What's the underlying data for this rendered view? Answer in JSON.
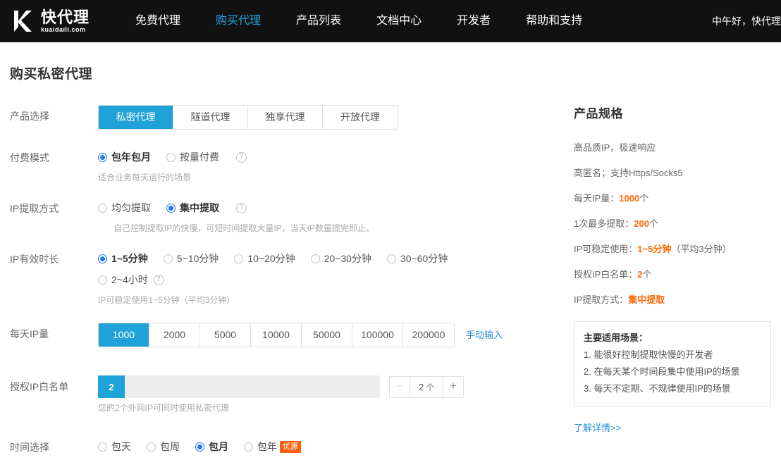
{
  "header": {
    "logo": {
      "cn": "快代理",
      "en": "kuaidaili.com",
      "icon": "k-logo-icon"
    },
    "nav": [
      {
        "label": "免费代理",
        "active": false
      },
      {
        "label": "购买代理",
        "active": true
      },
      {
        "label": "产品列表",
        "active": false
      },
      {
        "label": "文档中心",
        "active": false
      },
      {
        "label": "开发者",
        "active": false
      },
      {
        "label": "帮助和支持",
        "active": false
      }
    ],
    "greeting": "中午好，快代理",
    "active_color": "#2aa3e0",
    "background": "#111111"
  },
  "page": {
    "title": "购买私密代理",
    "accent": "#1fa2d8",
    "radio_accent": "#2277ee",
    "highlight": "#ff6a0a"
  },
  "form": {
    "product_select": {
      "label": "产品选择",
      "options": [
        "私密代理",
        "隧道代理",
        "独享代理",
        "开放代理"
      ],
      "selected": "私密代理"
    },
    "payment_mode": {
      "label": "付费模式",
      "options": [
        "包年包月",
        "按量付费"
      ],
      "selected": "包年包月",
      "help_icon": "question-mark-icon",
      "hint": "适合业务每天运行的场景"
    },
    "extract_method": {
      "label": "IP提取方式",
      "options": [
        "均匀提取",
        "集中提取"
      ],
      "selected": "集中提取",
      "help_icon": "question-mark-icon",
      "hint": "自己控制提取IP的快慢，可短时间提取大量IP，当天IP数量提完即止。"
    },
    "ip_duration": {
      "label": "IP有效时长",
      "options": [
        "1~5分钟",
        "5~10分钟",
        "10~20分钟",
        "20~30分钟",
        "30~60分钟",
        "2~4小时"
      ],
      "selected": "1~5分钟",
      "help_icon": "question-mark-icon",
      "hint": "IP可稳定使用1~5分钟（平均3分钟）"
    },
    "daily_ip": {
      "label": "每天IP量",
      "options": [
        "1000",
        "2000",
        "5000",
        "10000",
        "50000",
        "100000",
        "200000"
      ],
      "selected": "1000",
      "manual_link": "手动输入"
    },
    "whitelist": {
      "label": "授权IP白名单",
      "slider_value": "2",
      "stepper_minus": "−",
      "stepper_plus": "+",
      "stepper_value": "2",
      "stepper_unit": "个",
      "hint": "您的2个外网IP可同时使用私密代理"
    },
    "time_select": {
      "label": "时间选择",
      "options": [
        "包天",
        "包周",
        "包月",
        "包年"
      ],
      "selected": "包月",
      "sale_badge": "优惠"
    }
  },
  "spec": {
    "title": "产品规格",
    "lines": [
      {
        "text": "高品质IP，极速响应",
        "value": "",
        "suffix": ""
      },
      {
        "text": "高匿名；支持Https/Socks5",
        "value": "",
        "suffix": ""
      },
      {
        "text": "每天IP量：",
        "value": "1000",
        "suffix": "个"
      },
      {
        "text": "1次最多提取：",
        "value": "200",
        "suffix": "个"
      },
      {
        "text": "IP可稳定使用：",
        "value": "1~5分钟",
        "suffix": "（平均3分钟）"
      },
      {
        "text": "授权IP白名单：",
        "value": "2",
        "suffix": "个"
      },
      {
        "text": "IP提取方式：",
        "value": "集中提取",
        "suffix": ""
      }
    ],
    "box": {
      "title": "主要适用场景：",
      "items": [
        "1. 能很好控制提取快慢的开发者",
        "2. 在每天某个时间段集中使用IP的场景",
        "3. 每天不定期、不规律使用IP的场景"
      ]
    },
    "more_link": "了解详情>>"
  }
}
